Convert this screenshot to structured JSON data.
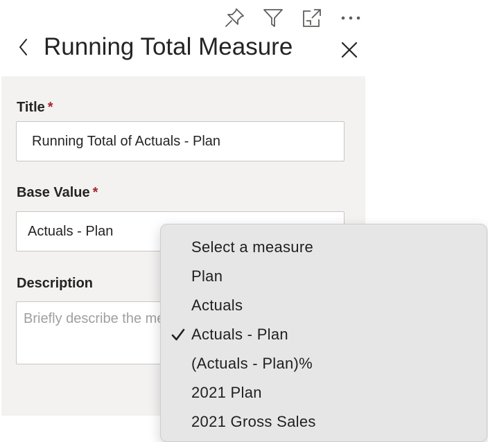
{
  "toolbar": {
    "items": [
      {
        "icon": "pin-icon"
      },
      {
        "icon": "filter-icon"
      },
      {
        "icon": "focus-mode-icon"
      },
      {
        "icon": "more-options-icon"
      }
    ]
  },
  "header": {
    "title": "Running Total Measure"
  },
  "form": {
    "title_field": {
      "label": "Title",
      "required_marker": "*",
      "value": "Running Total of Actuals - Plan"
    },
    "base_value_field": {
      "label": "Base Value",
      "required_marker": "*",
      "selected": "Actuals - Plan"
    },
    "description_field": {
      "label": "Description",
      "placeholder": "Briefly describe the measure"
    }
  },
  "dropdown": {
    "options": [
      {
        "label": "Select a measure"
      },
      {
        "label": "Plan"
      },
      {
        "label": "Actuals"
      },
      {
        "label": "Actuals - Plan",
        "checked": true
      },
      {
        "label": "(Actuals - Plan)%"
      },
      {
        "label": "2021 Plan"
      },
      {
        "label": "2021 Gross Sales"
      }
    ]
  },
  "colors": {
    "text": "#252423",
    "panel_bg": "#f3f2f1",
    "required": "#a4262c",
    "border": "#c8c6c4",
    "dropdown_bg": "#e6e6e6",
    "icon": "#605e5c"
  }
}
